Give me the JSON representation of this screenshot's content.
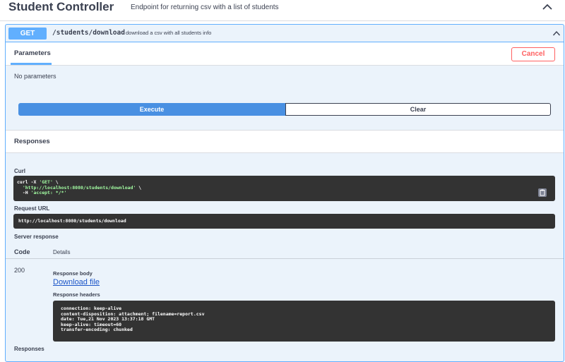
{
  "controller": {
    "title": "Student Controller",
    "description": "Endpoint for returning csv with a list of students"
  },
  "operation": {
    "method": "GET",
    "path": "/students/download",
    "summary": "download a csv with all students info"
  },
  "parameters": {
    "tab_label": "Parameters",
    "cancel_label": "Cancel",
    "empty_text": "No parameters"
  },
  "actions": {
    "execute_label": "Execute",
    "clear_label": "Clear"
  },
  "responses": {
    "title": "Responses",
    "curl_label": "Curl",
    "curl_cmd": "curl -X ",
    "curl_method": "'GET'",
    "curl_line1_tail": " \\",
    "curl_url": "'http://localhost:8080/students/download'",
    "curl_line2_tail": " \\",
    "curl_h": "-H ",
    "curl_accept": "'accept: */*'",
    "request_url_label": "Request URL",
    "request_url": "http://localhost:8080/students/download",
    "server_response_label": "Server response",
    "col_code": "Code",
    "col_details": "Details",
    "status_code": "200",
    "response_body_label": "Response body",
    "download_link": "Download file",
    "response_headers_label": "Response headers",
    "headers": [
      "connection: keep-alive",
      "content-disposition: attachment; filename=report.csv",
      "date: Tue,21 Nov 2023 13:37:18 GMT",
      "keep-alive: timeout=60",
      "transfer-encoding: chunked"
    ],
    "responses_label": "Responses"
  },
  "colors": {
    "get_accent": "#61affe",
    "get_bg": "#ebf3fb",
    "execute_blue": "#4990e2",
    "cancel_red": "#ff6060",
    "code_bg": "#333333"
  }
}
